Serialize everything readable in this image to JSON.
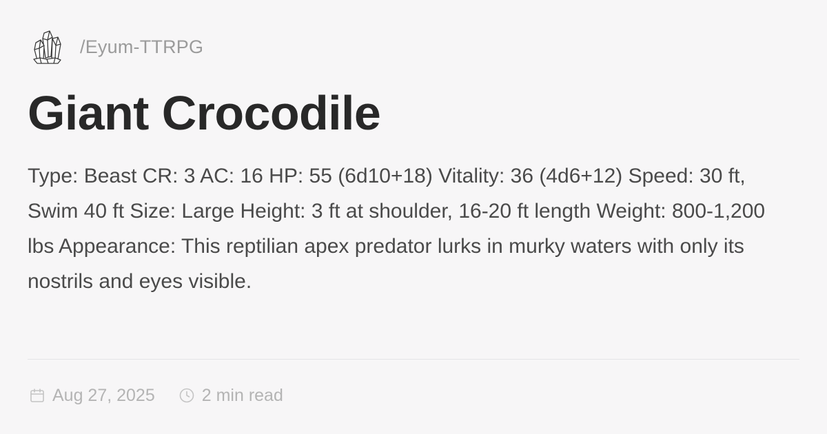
{
  "brand": {
    "logo_icon": "crystal-cluster-icon",
    "path": "/Eyum-TTRPG"
  },
  "article": {
    "title": "Giant Crocodile",
    "description": "Type: Beast CR: 3 AC: 16 HP: 55 (6d10+18) Vitality: 36 (4d6+12) Speed: 30 ft, Swim 40 ft Size: Large Height: 3 ft at shoulder, 16-20 ft length Weight: 800-1,200 lbs Appearance: This reptilian apex predator lurks in murky waters with only its nostrils and eyes visible."
  },
  "meta": {
    "date_icon": "calendar-icon",
    "date": "Aug 27, 2025",
    "read_time_icon": "clock-icon",
    "read_time": "2 min read"
  },
  "colors": {
    "background": "#f7f6f7",
    "title": "#282828",
    "body_text": "#4a4a4a",
    "muted": "#b4b4b4",
    "divider": "#e4e4e6"
  }
}
